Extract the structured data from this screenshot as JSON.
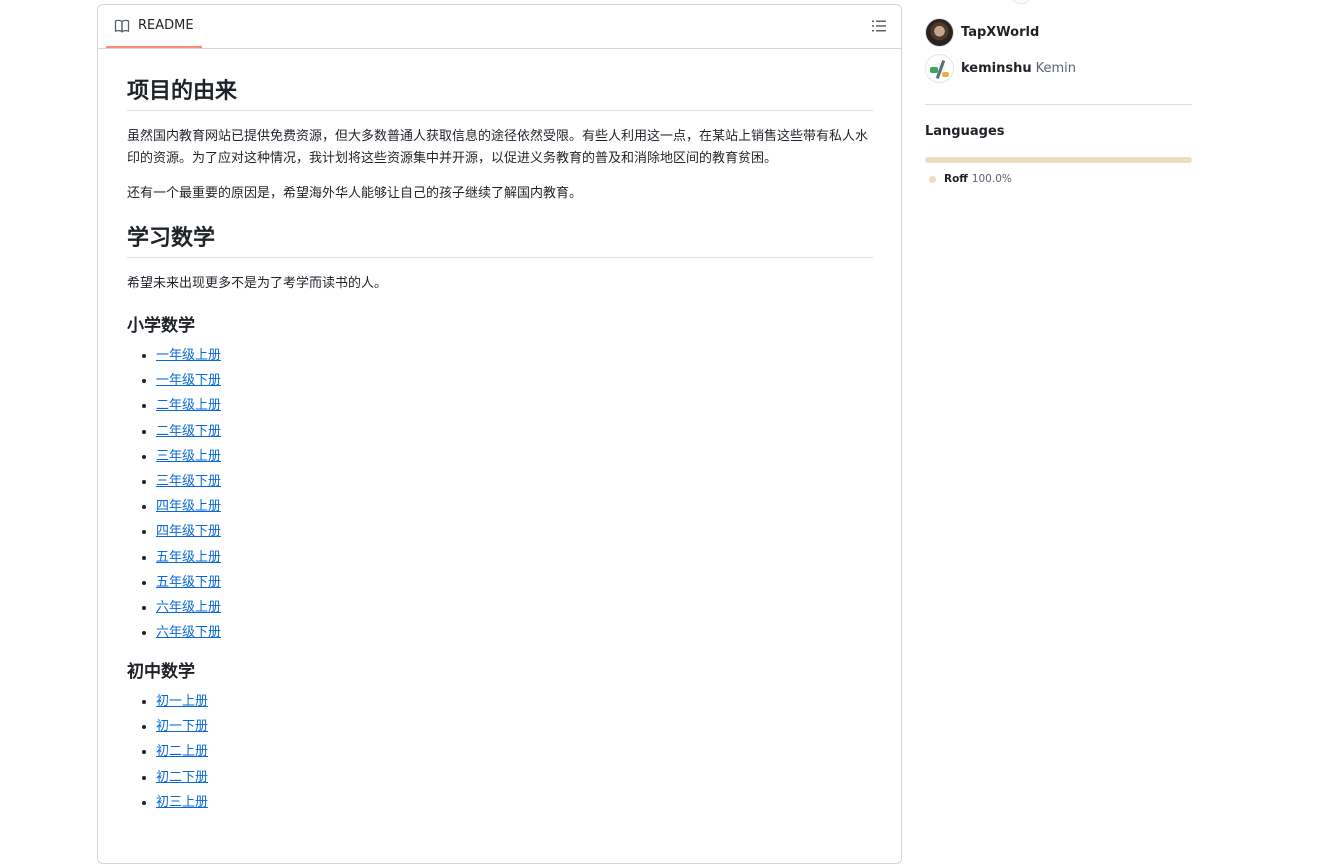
{
  "readme": {
    "tab_label": "README",
    "sections": {
      "origin_title": "项目的由来",
      "origin_p1": "虽然国内教育网站已提供免费资源，但大多数普通人获取信息的途径依然受限。有些人利用这一点，在某站上销售这些带有私人水印的资源。为了应对这种情况，我计划将这些资源集中并开源，以促进义务教育的普及和消除地区间的教育贫困。",
      "origin_p2": "还有一个最重要的原因是，希望海外华人能够让自己的孩子继续了解国内教育。",
      "math_title": "学习数学",
      "math_p": "希望未来出现更多不是为了考学而读书的人。",
      "primary_title": "小学数学",
      "primary_links": [
        "一年级上册",
        "一年级下册",
        "二年级上册",
        "二年级下册",
        "三年级上册",
        "三年级下册",
        "四年级上册",
        "四年级下册",
        "五年级上册",
        "五年级下册",
        "六年级上册",
        "六年级下册"
      ],
      "junior_title": "初中数学",
      "junior_links": [
        "初一上册",
        "初一下册",
        "初二上册",
        "初二下册",
        "初三上册"
      ]
    }
  },
  "sidebar": {
    "contributors": [
      {
        "login": "TapXWorld",
        "name": ""
      },
      {
        "login": "keminshu",
        "name": "Kemin"
      }
    ],
    "languages_title": "Languages",
    "languages": [
      {
        "name": "Roff",
        "percent": "100.0%",
        "color": "#ecdebe"
      }
    ]
  },
  "icons": {
    "readme_tab": "book-icon",
    "toc": "list-unordered-icon"
  }
}
